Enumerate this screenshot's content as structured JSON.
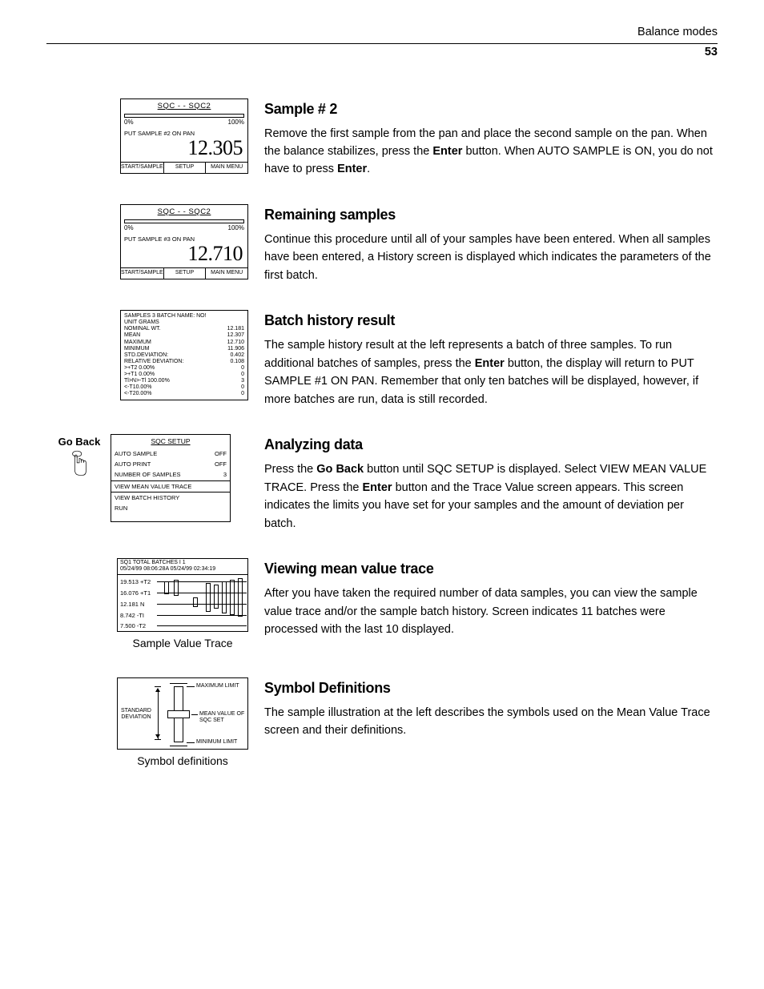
{
  "header": {
    "section": "Balance modes",
    "page": "53"
  },
  "lcd1": {
    "title": "SQC - - SQC2",
    "pct0": "0%",
    "pct100": "100%",
    "msg": "PUT SAMPLE #2 ON PAN",
    "value": "12.305",
    "btns": [
      "START/SAMPLE",
      "SETUP",
      "MAIN MENU"
    ]
  },
  "lcd2": {
    "title": "SQC - - SQC2",
    "pct0": "0%",
    "pct100": "100%",
    "msg": "PUT SAMPLE #3 ON PAN",
    "value": "12.710",
    "btns": [
      "START/SAMPLE",
      "SETUP",
      "MAIN MENU"
    ]
  },
  "history": {
    "l1a": "SAMPLES 3 BATCH NAME: NO!",
    "l1b": "",
    "l2": "UNIT GRAMS",
    "rows": [
      [
        "NOMINAL WT.",
        "12.181"
      ],
      [
        "MEAN",
        "12.307"
      ],
      [
        "MAXIMUM",
        "12.710"
      ],
      [
        "MINIMUM",
        "11.906"
      ],
      [
        "STD.DEVIATION:",
        "0.402"
      ],
      [
        "RELATIVE DEVIATION:",
        "0.108"
      ],
      [
        ">+T2 0.00%",
        "0"
      ],
      [
        ">+T1 0.00%",
        "0"
      ],
      [
        "Tl>N>-Tl 100.00%",
        "3"
      ],
      [
        "<-T10.00%",
        "0"
      ],
      [
        "<-T20.00%",
        "0"
      ]
    ]
  },
  "goback": "Go Back",
  "setup": {
    "title": "SQC SETUP",
    "rows": [
      [
        "AUTO SAMPLE",
        "OFF"
      ],
      [
        "AUTO PRINT",
        "OFF"
      ],
      [
        "NUMBER OF SAMPLES",
        "3"
      ]
    ],
    "highlight": "VIEW MEAN VALUE TRACE",
    "items": [
      "VIEW BATCH HISTORY",
      "RUN"
    ]
  },
  "trace": {
    "head1": "SQ1     TOTAL BATCHES I 1",
    "head2": "05/24/99  08:06:28A 05/24/99  02:34:19",
    "rows": [
      "19.513 +T2",
      "16.076 +T1",
      "12.181 N",
      "8.742 -TI",
      "7.500 -T2"
    ],
    "caption": "Sample Value Trace"
  },
  "symbols": {
    "max": "MAXIMUM LIMIT",
    "mean": "MEAN VALUE OF SQC SET",
    "min": "MINIMUM LIMIT",
    "std": "STANDARD\nDEVIATION",
    "caption": "Symbol definitions"
  },
  "sections": {
    "s1": {
      "h": "Sample # 2",
      "p1": "Remove the first sample from the pan and place the second sample on the pan. When the balance stabilizes, press the ",
      "b1": "Enter",
      "p2": " button. When AUTO SAMPLE is ON, you do not have to press ",
      "b2": "Enter",
      "p3": "."
    },
    "s2": {
      "h": "Remaining samples",
      "p": "Continue this procedure until all of your samples have been entered. When all samples have been entered, a History screen is displayed which indicates the parameters of the first batch."
    },
    "s3": {
      "h": "Batch history result",
      "p1": "The sample history result at the left represents a batch of three samples. To run additional batches of samples, press the ",
      "b1": "Enter",
      "p2": " button, the display will return to PUT SAMPLE #1 ON PAN. Remember that only ten batches will be displayed, however, if more batches are run, data is still recorded."
    },
    "s4": {
      "h": "Analyzing data",
      "p1": "Press the ",
      "b1": "Go Back",
      "p2": " button until SQC SETUP is displayed. Select VIEW MEAN VALUE TRACE. Press the ",
      "b2": "Enter",
      "p3": " button and the Trace Value screen appears. This screen indicates the limits you have set for your samples and the amount of deviation per batch."
    },
    "s5": {
      "h": "Viewing mean value trace",
      "p": "After you have taken the required number of data samples, you can view the sample value trace and/or the sample batch history. Screen indicates 11 batches were processed with the last 10 displayed."
    },
    "s6": {
      "h": "Symbol Definitions",
      "p": "The sample illustration at the left describes the symbols used on the Mean Value Trace screen and their definitions."
    }
  }
}
